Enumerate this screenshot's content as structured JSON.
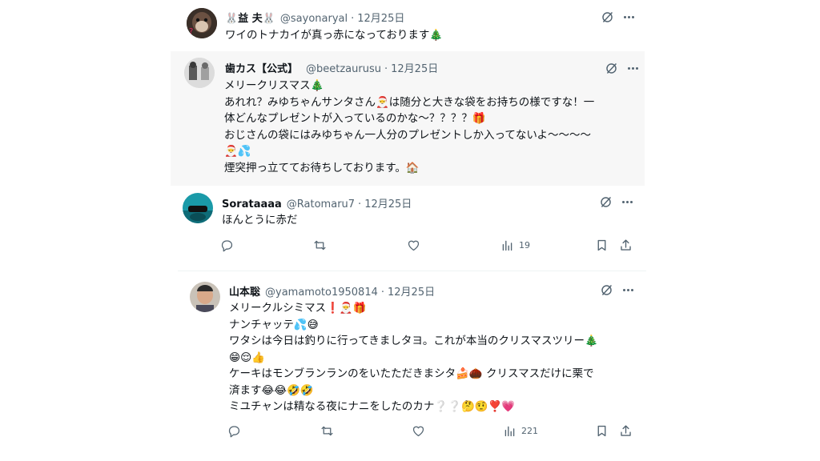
{
  "posts": [
    {
      "name": "🐰益 夫🐰",
      "handle": "@sayonaryal",
      "date": "12月25日",
      "lines": [
        "ワイのトナカイが真っ赤になっております🎄"
      ],
      "avatar_icon": "avatar-photo"
    },
    {
      "name": "歯カス【公式】",
      "handle": "@beetzaurusu",
      "date": "12月25日",
      "lines": [
        "メリークリスマス🎄",
        "あれれ？みゆちゃんサンタさん🎅は随分と大きな袋をお持ちの様ですな！一",
        "体どんなプレゼントが入っているのかな〜？？？？🎁",
        "おじさんの袋にはみゆちゃん一人分のプレゼントしか入ってないよ〜〜〜〜",
        "🎅💦",
        "煙突押っ立ててお待ちしております。🏠"
      ],
      "avatar_icon": "avatar-photo"
    },
    {
      "name": "Sorataaaa",
      "handle": "@Ratomaru7",
      "date": "12月25日",
      "lines": [
        "ほんとうに赤だ"
      ],
      "views": "19",
      "avatar_icon": "avatar-photo"
    },
    {
      "name": "山本聡",
      "handle": "@yamamoto1950814",
      "date": "12月25日",
      "lines": [
        "メリークルシミマス❗🎅🎁",
        "ナンチャッテ💦😅",
        "ワタシは今日は釣りに行ってきましタヨ。これが本当のクリスマスツリー🎄",
        "😁😌👍",
        "ケーキはモンブランランのをいたただきまシタ🍰🌰 クリスマスだけに栗で",
        "済ます😂😂🤣🤣",
        "ミユチャンは精なる夜にナニをしたのカナ❔❔🤔🤨❣️💗"
      ],
      "views": "221",
      "avatar_icon": "avatar-photo"
    }
  ],
  "icons": {
    "grok": "grok-icon",
    "more": "more-icon",
    "reply": "reply-icon",
    "repost": "repost-icon",
    "like": "like-icon",
    "views": "views-icon",
    "bookmark": "bookmark-icon",
    "share": "share-icon"
  },
  "colors": {
    "text": "#0f1419",
    "secondary": "#536471",
    "quote_bg": "#f7f7f7"
  }
}
